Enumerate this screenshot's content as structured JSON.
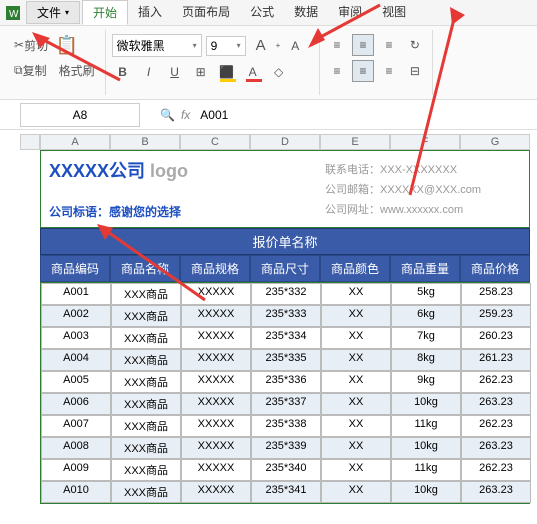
{
  "menubar": {
    "file": "文件",
    "tabs": [
      "开始",
      "插入",
      "页面布局",
      "公式",
      "数据",
      "审阅",
      "视图"
    ]
  },
  "ribbon": {
    "cut": "剪切",
    "copy": "复制",
    "paste": "格式刷",
    "font_name": "微软雅黑",
    "font_size": "9",
    "big_a": "A",
    "small_a": "A"
  },
  "namebox": "A8",
  "formula": "A001",
  "columns": [
    "A",
    "B",
    "C",
    "D",
    "E",
    "F",
    "G"
  ],
  "top": {
    "company": "XXXXX公司",
    "logo": "logo",
    "slogan": "公司标语：感谢您的选择",
    "phone": "联系电话：XXX-XXXXXXX",
    "email": "公司邮箱：XXXXXX@XXX.com",
    "site": "公司网址：www.xxxxxx.com"
  },
  "table": {
    "title": "报价单名称",
    "headers": [
      "商品编码",
      "商品名称",
      "商品规格",
      "商品尺寸",
      "商品颜色",
      "商品重量",
      "商品价格"
    ],
    "rows": [
      [
        "A001",
        "XXX商品",
        "XXXXX",
        "235*332",
        "XX",
        "5kg",
        "258.23"
      ],
      [
        "A002",
        "XXX商品",
        "XXXXX",
        "235*333",
        "XX",
        "6kg",
        "259.23"
      ],
      [
        "A003",
        "XXX商品",
        "XXXXX",
        "235*334",
        "XX",
        "7kg",
        "260.23"
      ],
      [
        "A004",
        "XXX商品",
        "XXXXX",
        "235*335",
        "XX",
        "8kg",
        "261.23"
      ],
      [
        "A005",
        "XXX商品",
        "XXXXX",
        "235*336",
        "XX",
        "9kg",
        "262.23"
      ],
      [
        "A006",
        "XXX商品",
        "XXXXX",
        "235*337",
        "XX",
        "10kg",
        "263.23"
      ],
      [
        "A007",
        "XXX商品",
        "XXXXX",
        "235*338",
        "XX",
        "11kg",
        "262.23"
      ],
      [
        "A008",
        "XXX商品",
        "XXXXX",
        "235*339",
        "XX",
        "10kg",
        "263.23"
      ],
      [
        "A009",
        "XXX商品",
        "XXXXX",
        "235*340",
        "XX",
        "11kg",
        "262.23"
      ],
      [
        "A010",
        "XXX商品",
        "XXXXX",
        "235*341",
        "XX",
        "10kg",
        "263.23"
      ]
    ]
  }
}
